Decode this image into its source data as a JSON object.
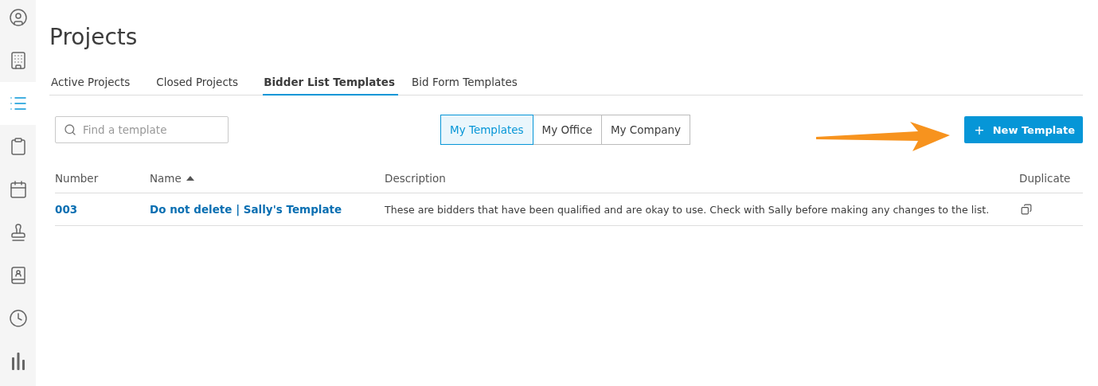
{
  "sidebar": {
    "items": [
      {
        "selected": false
      },
      {
        "selected": false
      },
      {
        "selected": true
      },
      {
        "selected": false
      },
      {
        "selected": false
      },
      {
        "selected": false
      },
      {
        "selected": false
      },
      {
        "selected": false
      },
      {
        "selected": false
      }
    ]
  },
  "page": {
    "title": "Projects"
  },
  "tabs": [
    {
      "label": "Active Projects",
      "selected": false
    },
    {
      "label": "Closed Projects",
      "selected": false
    },
    {
      "label": "Bidder List Templates",
      "selected": true
    },
    {
      "label": "Bid Form Templates",
      "selected": false
    }
  ],
  "search": {
    "placeholder": "Find a template"
  },
  "filters": [
    {
      "label": "My Templates",
      "selected": true
    },
    {
      "label": "My Office",
      "selected": false
    },
    {
      "label": "My Company",
      "selected": false
    }
  ],
  "new_button": {
    "icon": "+",
    "label": "New Template"
  },
  "table": {
    "columns": [
      {
        "label": "Number",
        "sorted": false
      },
      {
        "label": "Name",
        "sorted": true
      },
      {
        "label": "Description",
        "sorted": false
      },
      {
        "label": "Duplicate",
        "sorted": false
      }
    ],
    "rows": [
      {
        "number": "003",
        "name": "Do not delete | Sally's Template",
        "description": "These are bidders that have been qualified and are okay to use. Check with Sally before making any changes to the list."
      }
    ]
  }
}
